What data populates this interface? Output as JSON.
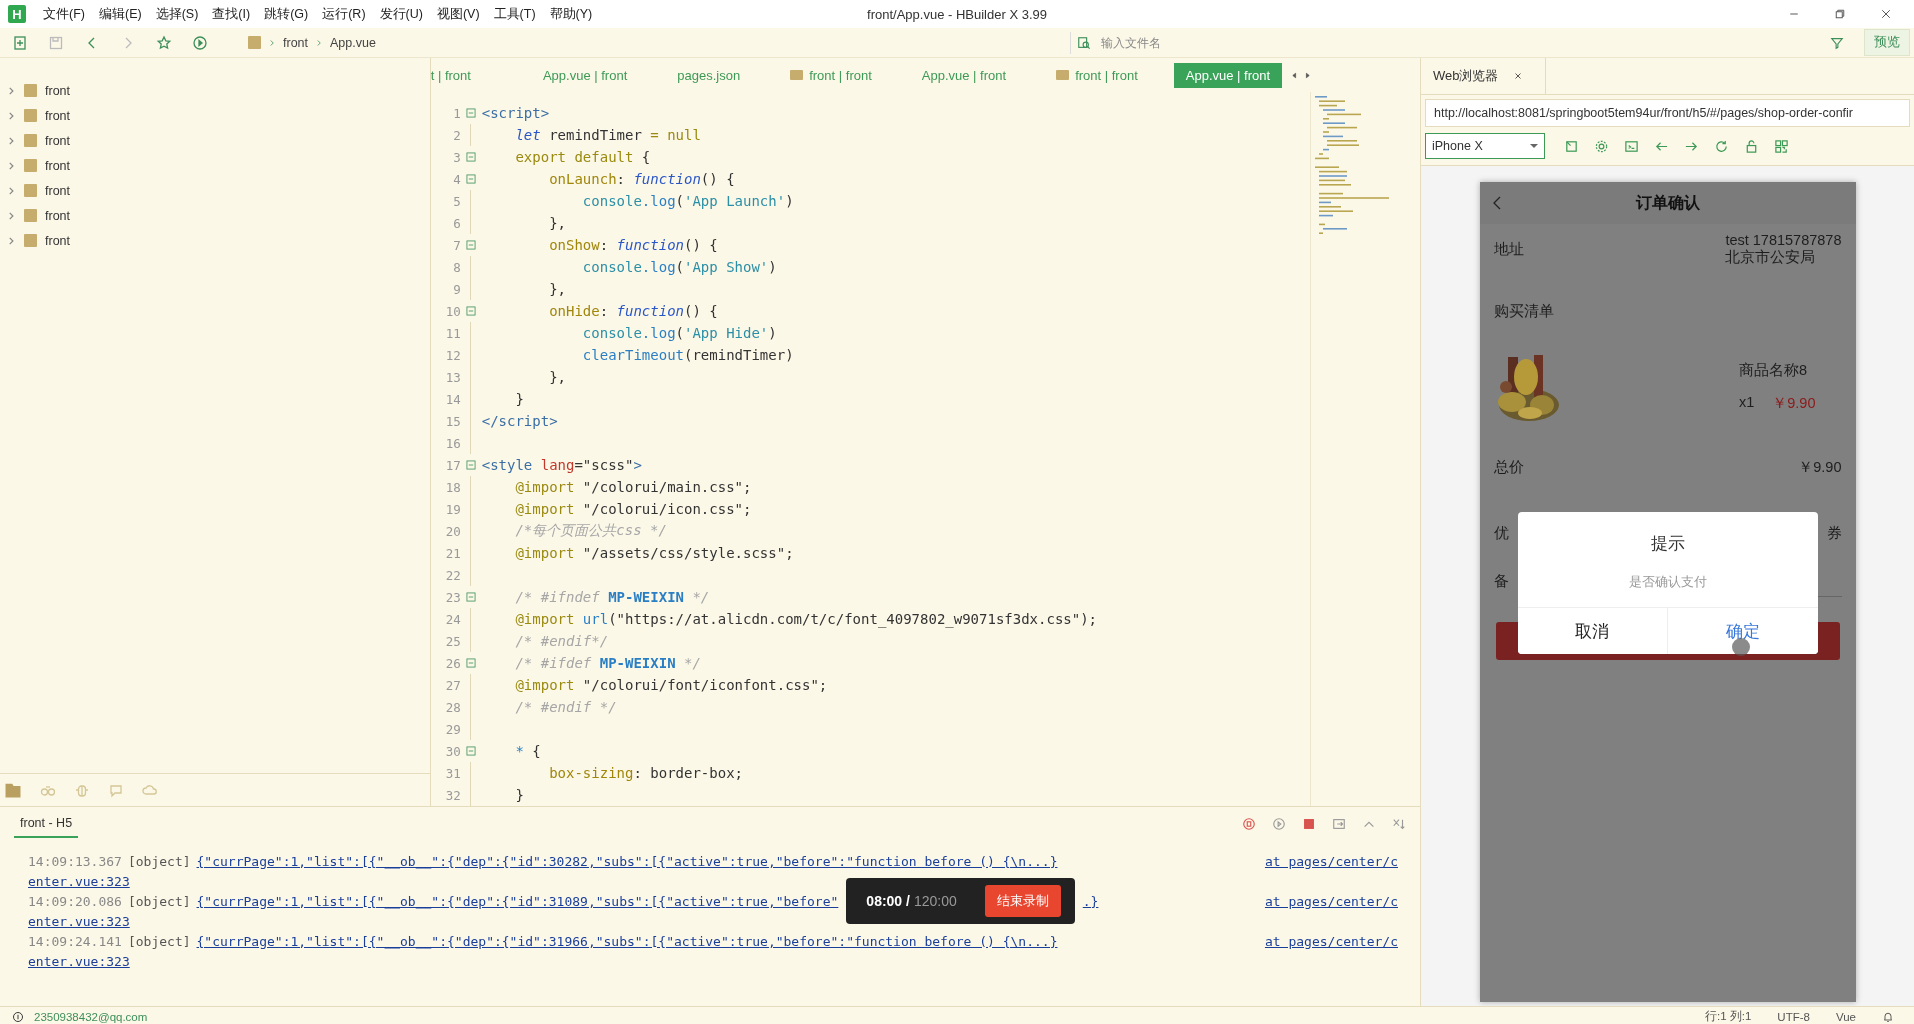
{
  "window": {
    "logo": "H",
    "title": "front/App.vue - HBuilder X 3.99"
  },
  "menu": [
    "文件(F)",
    "编辑(E)",
    "选择(S)",
    "查找(I)",
    "跳转(G)",
    "运行(R)",
    "发行(U)",
    "视图(V)",
    "工具(T)",
    "帮助(Y)"
  ],
  "toolbar": {
    "breadcrumb": [
      "front",
      "App.vue"
    ],
    "search": {
      "placeholder": "输入文件名"
    },
    "preview_button": "预览"
  },
  "sidebar": {
    "items": [
      {
        "label": "front",
        "expanded": false
      },
      {
        "label": "front",
        "expanded": false
      },
      {
        "label": "front",
        "expanded": false
      },
      {
        "label": "front",
        "expanded": false
      },
      {
        "label": "front",
        "expanded": false
      },
      {
        "label": "front",
        "expanded": false
      },
      {
        "label": "front",
        "expanded": false
      }
    ]
  },
  "editor": {
    "tabs": [
      {
        "label": "t | front",
        "kind": "file",
        "selected": false
      },
      {
        "label": "App.vue | front",
        "kind": "file",
        "selected": false
      },
      {
        "label": "pages.json",
        "kind": "file",
        "selected": false
      },
      {
        "label": "front | front",
        "kind": "folder",
        "selected": false
      },
      {
        "label": "App.vue | front",
        "kind": "file",
        "selected": false
      },
      {
        "label": "front | front",
        "kind": "folder",
        "selected": false
      },
      {
        "label": "App.vue | front",
        "kind": "file",
        "selected": true
      }
    ],
    "lines": [
      {
        "n": "1",
        "fold": true,
        "tokens": [
          {
            "kind": "tag",
            "text": "<script>"
          }
        ]
      },
      {
        "n": "2",
        "fold": false,
        "tokens": [
          {
            "kind": "kwi",
            "text": "    let"
          },
          {
            "kind": "plain",
            "text": " remindTimer "
          },
          {
            "kind": "kw",
            "text": "= null"
          }
        ]
      },
      {
        "n": "3",
        "fold": true,
        "tokens": [
          {
            "kind": "kw",
            "text": "    export default"
          },
          {
            "kind": "plain",
            "text": " {"
          }
        ]
      },
      {
        "n": "4",
        "fold": true,
        "tokens": [
          {
            "kind": "prop",
            "text": "        onLaunch"
          },
          {
            "kind": "plain",
            "text": ": "
          },
          {
            "kind": "kwi",
            "text": "function"
          },
          {
            "kind": "plain",
            "text": "() {"
          }
        ]
      },
      {
        "n": "5",
        "fold": false,
        "tokens": [
          {
            "kind": "obj",
            "text": "            console"
          },
          {
            "kind": "fn",
            "text": ".log"
          },
          {
            "kind": "plain",
            "text": "("
          },
          {
            "kind": "str",
            "text": "'App Launch'"
          },
          {
            "kind": "plain",
            "text": ")"
          }
        ]
      },
      {
        "n": "6",
        "fold": false,
        "tokens": [
          {
            "kind": "plain",
            "text": "        },"
          }
        ]
      },
      {
        "n": "7",
        "fold": true,
        "tokens": [
          {
            "kind": "prop",
            "text": "        onShow"
          },
          {
            "kind": "plain",
            "text": ": "
          },
          {
            "kind": "kwi",
            "text": "function"
          },
          {
            "kind": "plain",
            "text": "() {"
          }
        ]
      },
      {
        "n": "8",
        "fold": false,
        "tokens": [
          {
            "kind": "obj",
            "text": "            console"
          },
          {
            "kind": "fn",
            "text": ".log"
          },
          {
            "kind": "plain",
            "text": "("
          },
          {
            "kind": "str",
            "text": "'App Show'"
          },
          {
            "kind": "plain",
            "text": ")"
          }
        ]
      },
      {
        "n": "9",
        "fold": false,
        "tokens": [
          {
            "kind": "plain",
            "text": "        },"
          }
        ]
      },
      {
        "n": "10",
        "fold": true,
        "tokens": [
          {
            "kind": "prop",
            "text": "        onHide"
          },
          {
            "kind": "plain",
            "text": ": "
          },
          {
            "kind": "kwi",
            "text": "function"
          },
          {
            "kind": "plain",
            "text": "() {"
          }
        ]
      },
      {
        "n": "11",
        "fold": false,
        "tokens": [
          {
            "kind": "obj",
            "text": "            console"
          },
          {
            "kind": "fn",
            "text": ".log"
          },
          {
            "kind": "plain",
            "text": "("
          },
          {
            "kind": "str",
            "text": "'App Hide'"
          },
          {
            "kind": "plain",
            "text": ")"
          }
        ]
      },
      {
        "n": "12",
        "fold": false,
        "tokens": [
          {
            "kind": "fn",
            "text": "            clearTimeout"
          },
          {
            "kind": "plain",
            "text": "(remindTimer)"
          }
        ]
      },
      {
        "n": "13",
        "fold": false,
        "tokens": [
          {
            "kind": "plain",
            "text": "        },"
          }
        ]
      },
      {
        "n": "14",
        "fold": false,
        "tokens": [
          {
            "kind": "plain",
            "text": "    }"
          }
        ]
      },
      {
        "n": "15",
        "fold": false,
        "tokens": [
          {
            "kind": "tag",
            "text": "</script>"
          }
        ]
      },
      {
        "n": "16",
        "fold": false
      },
      {
        "n": "17",
        "fold": true,
        "tokens": [
          {
            "kind": "tag",
            "text": "<style "
          },
          {
            "kind": "attr",
            "text": "lang"
          },
          {
            "kind": "plain",
            "text": "=\"scss\""
          },
          {
            "kind": "tag",
            "text": ">"
          }
        ]
      },
      {
        "n": "18",
        "fold": false,
        "tokens": [
          {
            "kind": "kw",
            "text": "    @import"
          },
          {
            "kind": "plain",
            "text": " \"/colorui/main.css\";"
          }
        ]
      },
      {
        "n": "19",
        "fold": false,
        "tokens": [
          {
            "kind": "kw",
            "text": "    @import"
          },
          {
            "kind": "plain",
            "text": " \"/colorui/icon.css\";"
          }
        ]
      },
      {
        "n": "20",
        "fold": false,
        "tokens": [
          {
            "kind": "cmt",
            "text": "    /*每个页面公共css */"
          }
        ]
      },
      {
        "n": "21",
        "fold": false,
        "tokens": [
          {
            "kind": "kw",
            "text": "    @import"
          },
          {
            "kind": "plain",
            "text": " \"/assets/css/style.scss\";"
          }
        ]
      },
      {
        "n": "22",
        "fold": false
      },
      {
        "n": "23",
        "fold": true,
        "tokens": [
          {
            "kind": "cmt",
            "text": "    /* #ifndef "
          },
          {
            "kind": "macro",
            "text": "MP-WEIXIN"
          },
          {
            "kind": "cmt",
            "text": " */"
          }
        ]
      },
      {
        "n": "24",
        "fold": false,
        "tokens": [
          {
            "kind": "kw",
            "text": "    @import "
          },
          {
            "kind": "fn",
            "text": "url"
          },
          {
            "kind": "plain",
            "text": "(\"https://at.alicdn.com/t/c/font_4097802_w9071sf3dx.css\");"
          }
        ]
      },
      {
        "n": "25",
        "fold": false,
        "tokens": [
          {
            "kind": "cmt",
            "text": "    /* #endif*/"
          }
        ]
      },
      {
        "n": "26",
        "fold": true,
        "tokens": [
          {
            "kind": "cmt",
            "text": "    /* #ifdef "
          },
          {
            "kind": "macro",
            "text": "MP-WEIXIN"
          },
          {
            "kind": "cmt",
            "text": " */"
          }
        ]
      },
      {
        "n": "27",
        "fold": false,
        "tokens": [
          {
            "kind": "kw",
            "text": "    @import"
          },
          {
            "kind": "plain",
            "text": " \"/colorui/font/iconfont.css\";"
          }
        ]
      },
      {
        "n": "28",
        "fold": false,
        "tokens": [
          {
            "kind": "cmt",
            "text": "    /* #endif */"
          }
        ]
      },
      {
        "n": "29",
        "fold": false
      },
      {
        "n": "30",
        "fold": true,
        "tokens": [
          {
            "kind": "fn",
            "text": "    *"
          },
          {
            "kind": "plain",
            "text": " {"
          }
        ]
      },
      {
        "n": "31",
        "fold": false,
        "tokens": [
          {
            "kind": "prop",
            "text": "        box-sizing"
          },
          {
            "kind": "plain",
            "text": ": border-box;"
          }
        ]
      },
      {
        "n": "32",
        "fold": false,
        "tokens": [
          {
            "kind": "plain",
            "text": "    }"
          }
        ]
      }
    ]
  },
  "console": {
    "tab": "front - H5",
    "entries": [
      {
        "time": "14:09:13.367",
        "type": "[object]",
        "link": [
          "{\"currPage\":1,\"list\":[{\"__ob__\":{\"dep\":{\"id\":30282,\"subs\":[{\"active\":true,\"before\":\"function before () {\\n...}"
        ],
        "location": [
          "at pages/center/c",
          "enter.vue:323"
        ]
      },
      {
        "time": "14:09:20.086",
        "type": "[object]",
        "link": [
          "{\"currPage\":1,\"list\":[{\"__ob__\":{\"dep\":{\"id\":31089,\"subs\":[{\"active\":true,\"before\"",
          ".}"
        ],
        "location": [
          "at pages/center/c",
          "enter.vue:323"
        ]
      },
      {
        "time": "14:09:24.141",
        "type": "[object]",
        "link": [
          "{\"currPage\":1,\"list\":[{\"__ob__\":{\"dep\":{\"id\":31966,\"subs\":[{\"active\":true,\"before\":\"function before () {\\n...}"
        ],
        "location": [
          "at pages/center/c",
          "enter.vue:323"
        ]
      }
    ]
  },
  "recorder": {
    "elapsed": "08:00 /",
    "limit": "120:00",
    "stop_button": "结束录制"
  },
  "browser": {
    "tab": "Web浏览器",
    "url": "http://localhost:8081/springboot5tem94ur/front/h5/#/pages/shop-order-confir",
    "device": "iPhone X",
    "page": {
      "title": "订单确认",
      "address_label": "地址",
      "address": [
        "test 17815787878",
        "北京市公安局"
      ],
      "list_label": "购买清单",
      "product": {
        "name": "商品名称8",
        "qty": "x1",
        "price": "￥9.90"
      },
      "total_label": "总价",
      "total": "￥9.90",
      "coupon_label": "优",
      "coupon_value": "券",
      "note_label": "备",
      "dialog": {
        "title": "提示",
        "message": "是否确认支付",
        "cancel": "取消",
        "confirm": "确定"
      }
    }
  },
  "status_bar": {
    "account": "2350938432@qq.com",
    "position": "行:1  列:1",
    "encoding": "UTF-8",
    "language": "Vue"
  }
}
